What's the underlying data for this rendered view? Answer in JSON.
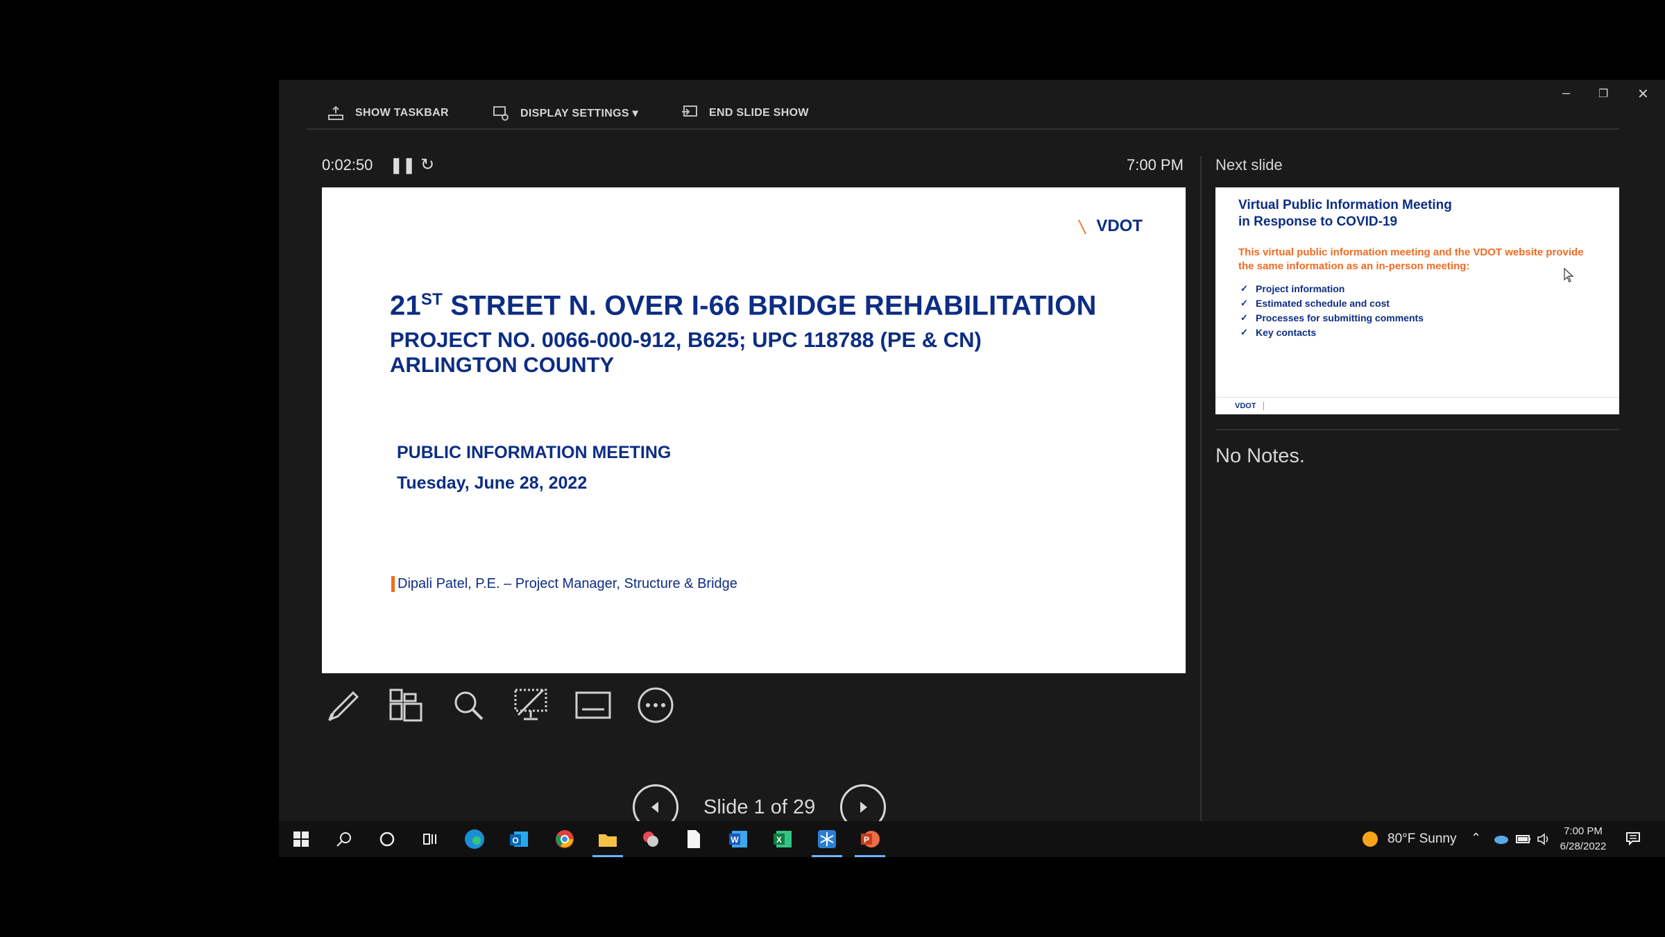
{
  "toolbar": {
    "show_taskbar": "SHOW TASKBAR",
    "display_settings": "DISPLAY SETTINGS ▾",
    "end_slide_show": "END SLIDE SHOW"
  },
  "presenter": {
    "elapsed_time": "0:02:50",
    "clock": "7:00 PM",
    "next_slide_label": "Next slide",
    "notes": "No Notes.",
    "slide_counter": "Slide 1 of 29"
  },
  "current_slide": {
    "logo": "VDOT",
    "title_num": "21",
    "title_sup": "ST",
    "title_rest": " STREET N. OVER I-66 BRIDGE REHABILITATION",
    "project": "PROJECT NO. 0066-000-912, B625; UPC 118788 (PE & CN)",
    "county": "ARLINGTON COUNTY",
    "meeting": "PUBLIC INFORMATION MEETING",
    "date": "Tuesday, June 28, 2022",
    "presenter": "Dipali Patel, P.E. – Project Manager, Structure & Bridge"
  },
  "next_slide": {
    "title_line1": "Virtual Public Information Meeting",
    "title_line2": "in Response to COVID-19",
    "intro": "This virtual public information meeting and the VDOT website provide the same information as an in-person meeting:",
    "items": [
      "Project information",
      "Estimated schedule and cost",
      "Processes for submitting comments",
      "Key contacts"
    ],
    "footer_logo": "VDOT"
  },
  "taskbar": {
    "weather": "80°F  Sunny",
    "time": "7:00 PM",
    "date": "6/28/2022"
  },
  "colors": {
    "vdot_blue": "#0c2d83",
    "vdot_orange": "#f26b21",
    "accent": "#6eb4ff"
  }
}
